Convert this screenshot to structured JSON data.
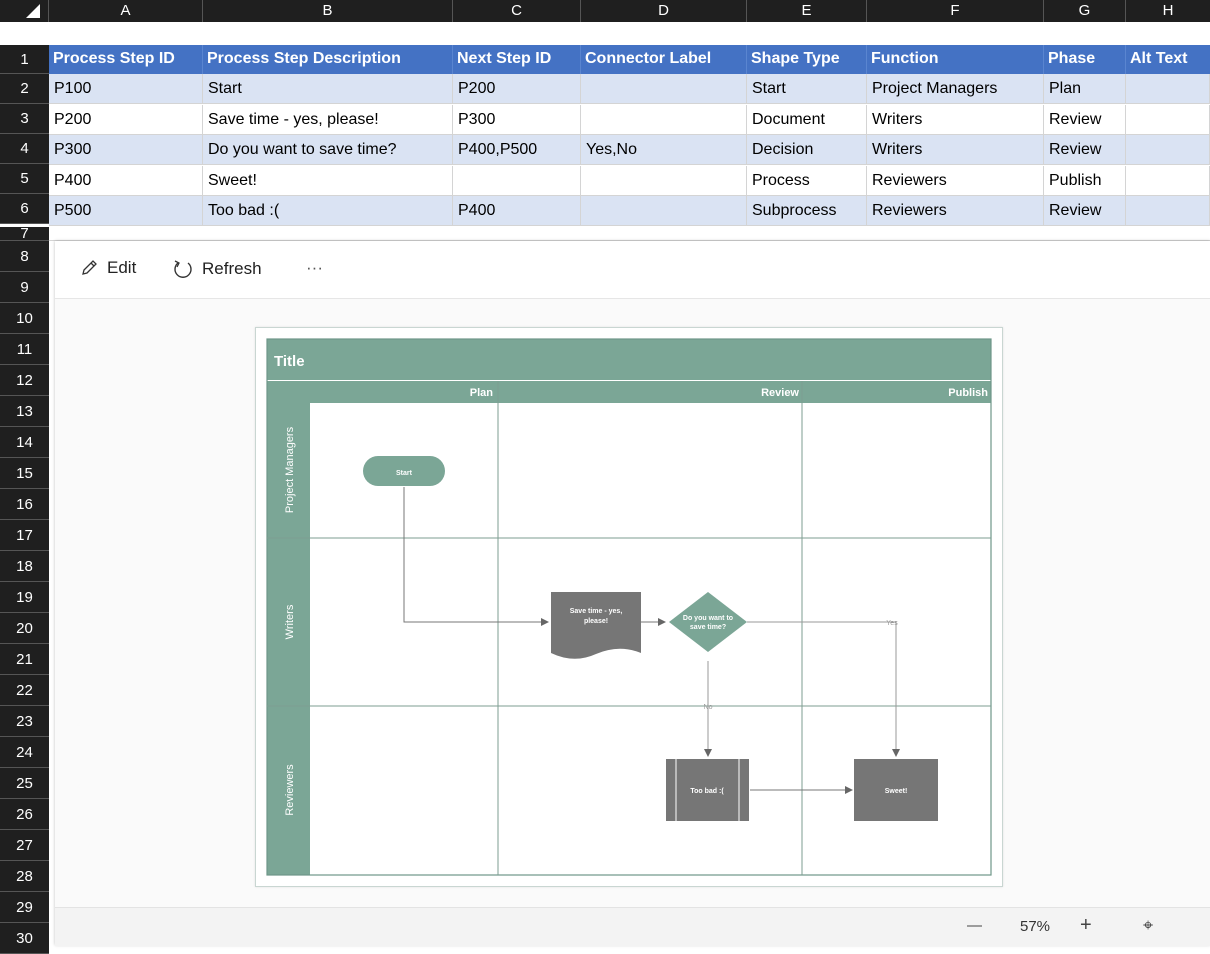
{
  "corner": "",
  "columns": [
    "A",
    "B",
    "C",
    "D",
    "E",
    "F",
    "G",
    "H"
  ],
  "row_numbers": [
    "1",
    "2",
    "3",
    "4",
    "5",
    "6",
    "7",
    "8",
    "9",
    "10",
    "11",
    "12",
    "13",
    "14",
    "15",
    "16",
    "17",
    "18",
    "19",
    "20",
    "21",
    "22",
    "23",
    "24",
    "25",
    "26",
    "27",
    "28",
    "29",
    "30"
  ],
  "table": {
    "headers": [
      "Process Step ID",
      "Process Step Description",
      "Next Step ID",
      "Connector Label",
      "Shape Type",
      "Function",
      "Phase",
      "Alt Text"
    ],
    "rows": [
      [
        "P100",
        "Start",
        "P200",
        "",
        "Start",
        "Project Managers",
        "Plan",
        ""
      ],
      [
        "P200",
        "Save time - yes, please!",
        "P300",
        "",
        "Document",
        "Writers",
        "Review",
        ""
      ],
      [
        "P300",
        "Do you want to save time?",
        "P400,P500",
        "Yes,No",
        "Decision",
        "Writers",
        "Review",
        ""
      ],
      [
        "P400",
        "Sweet!",
        "",
        "",
        "Process",
        "Reviewers",
        "Publish",
        ""
      ],
      [
        "P500",
        "Too bad :(",
        "P400",
        "",
        "Subprocess",
        "Reviewers",
        "Review",
        ""
      ]
    ]
  },
  "toolbar": {
    "edit_label": "Edit",
    "refresh_label": "Refresh",
    "more_label": "···"
  },
  "diagram": {
    "title": "Title",
    "phases": [
      "Plan",
      "Review",
      "Publish"
    ],
    "lanes": [
      "Project Managers",
      "Writers",
      "Reviewers"
    ],
    "shapes": {
      "start": "Start",
      "document_line1": "Save time - yes,",
      "document_line2": "please!",
      "decision_line1": "Do you want to",
      "decision_line2": "save time?",
      "subprocess": "Too bad :(",
      "process": "Sweet!"
    },
    "connectors": {
      "yes": "Yes",
      "no": "No"
    },
    "colors": {
      "header": "#7ba696",
      "lane_label": "#7ba696",
      "shape_dark": "#767676",
      "start_fill": "#7ba696"
    }
  },
  "status": {
    "zoom_out": "—",
    "zoom": "57%",
    "zoom_in": "+",
    "fit": "⌖"
  }
}
